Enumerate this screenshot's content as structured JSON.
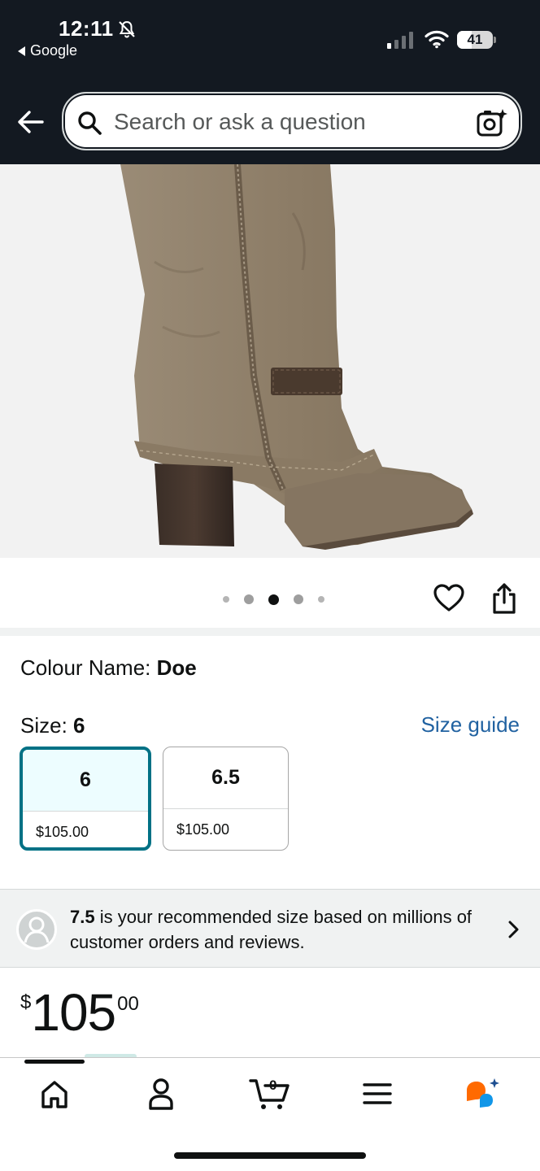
{
  "status_bar": {
    "time": "12:11",
    "back_app": "Google",
    "battery": "41",
    "battery_fraction": 0.41
  },
  "search": {
    "placeholder": "Search or ask a question"
  },
  "carousel": {
    "dot_count": 5,
    "active_index": 2
  },
  "product": {
    "colour_label": "Colour Name:",
    "colour_value": "Doe",
    "size_label": "Size:",
    "size_value": "6",
    "size_guide": "Size guide",
    "sizes": [
      {
        "size": "6",
        "price": "$105.00",
        "selected": true
      },
      {
        "size": "6.5",
        "price": "$105.00",
        "selected": false
      }
    ],
    "recommendation": {
      "size": "7.5",
      "text": "is your recommended size based on millions of customer orders and reviews."
    },
    "price": {
      "currency": "$",
      "whole": "105",
      "fraction": "00"
    }
  },
  "bottom_nav": {
    "cart_count": "0",
    "items": [
      "home",
      "account",
      "cart",
      "menu",
      "rufus"
    ]
  },
  "colors": {
    "header_bg": "#131921",
    "link": "#2162a1",
    "selected_border": "#007185",
    "rufus_orange": "#ff6a00",
    "rufus_blue": "#1196e8"
  }
}
